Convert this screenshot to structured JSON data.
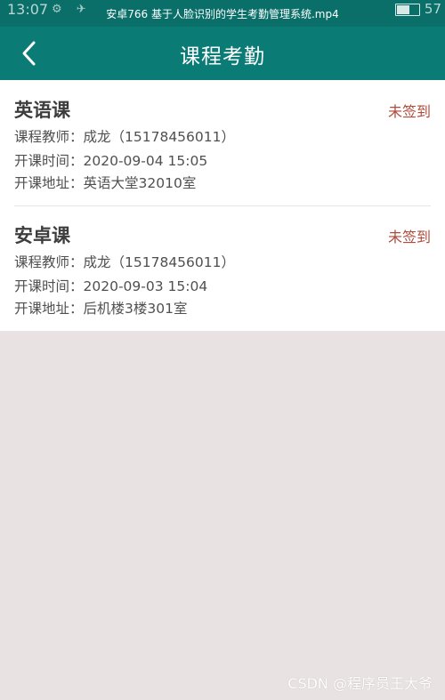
{
  "status_bar": {
    "time": "13:07",
    "video_title": "安卓766 基于人脸识别的学生考勤管理系统.mp4",
    "battery_text": "57"
  },
  "app_bar": {
    "title": "课程考勤",
    "back_icon": "chevron-left-icon"
  },
  "courses": [
    {
      "name": "英语课",
      "status": "未签到",
      "teacher_label": "课程教师：",
      "teacher": "成龙（15178456011）",
      "time_label": "开课时间：",
      "time": "2020-09-04 15:05",
      "location_label": "开课地址：",
      "location": "英语大堂32010室"
    },
    {
      "name": "安卓课",
      "status": "未签到",
      "teacher_label": "课程教师：",
      "teacher": "成龙（15178456011）",
      "time_label": "开课时间：",
      "time": "2020-09-03 15:04",
      "location_label": "开课地址：",
      "location": "后机楼3楼301室"
    }
  ],
  "watermark": "CSDN @程序员王大爷",
  "colors": {
    "primary": "#0b7b75",
    "status_red": "#b04a3a",
    "background": "#e8e3e2"
  }
}
